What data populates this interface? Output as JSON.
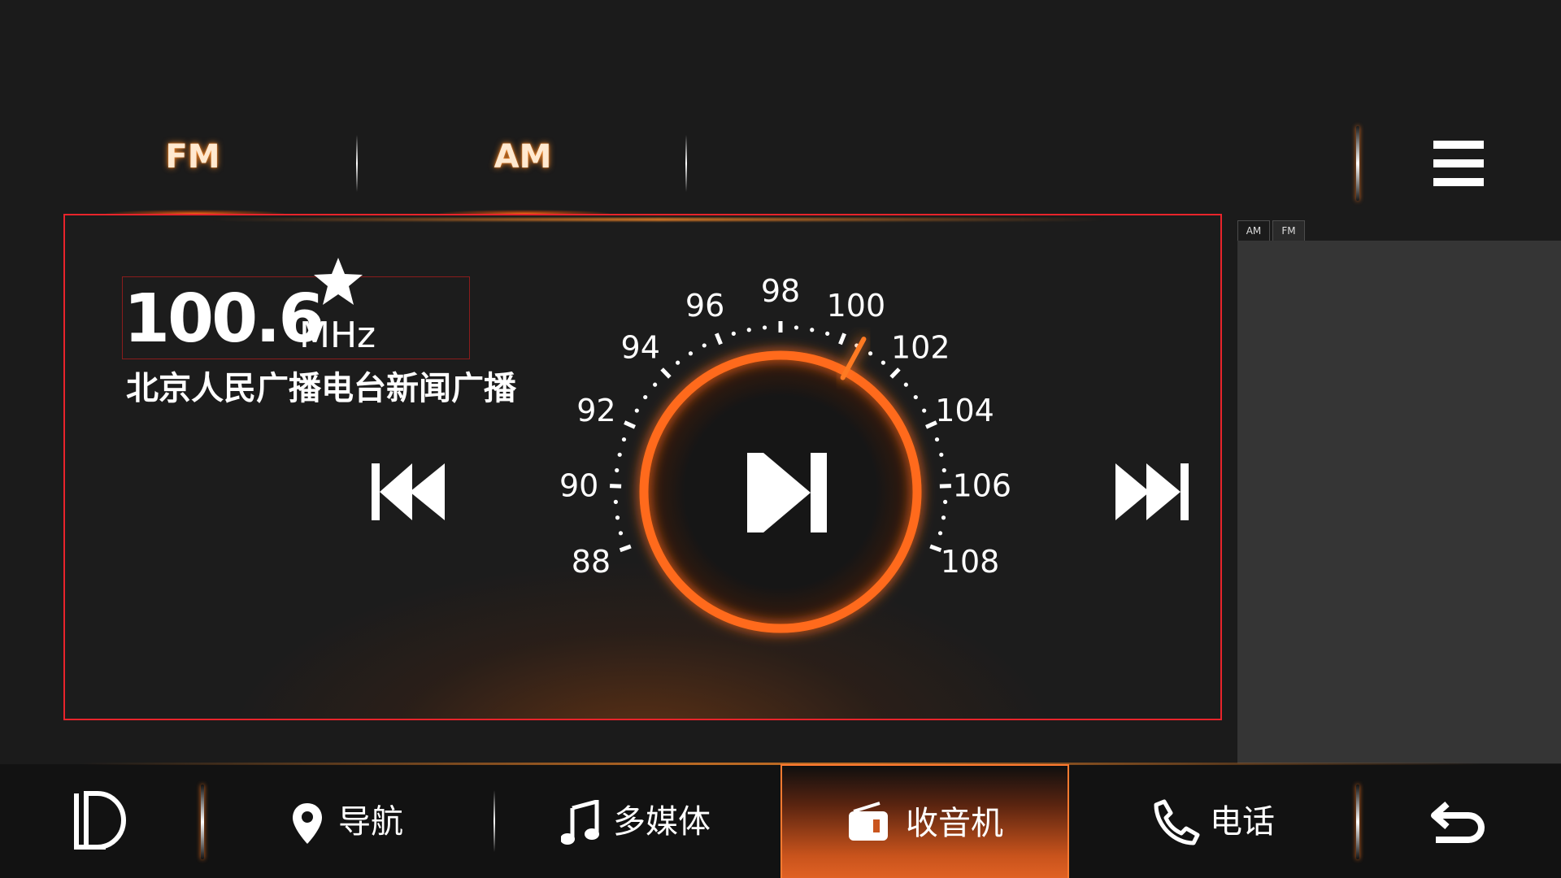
{
  "bands": {
    "fm_label": "FM",
    "am_label": "AM",
    "active": "FM"
  },
  "tuner": {
    "frequency": "100.6",
    "unit": "MHz",
    "station_name": "北京人民广播电台新闻广播",
    "favorite": true,
    "dial_min": 88,
    "dial_max": 108,
    "dial_labels": [
      "88",
      "90",
      "92",
      "94",
      "96",
      "98",
      "100",
      "102",
      "104",
      "106",
      "108"
    ],
    "current_value": 100.6
  },
  "side_panel": {
    "tabs": [
      "AM",
      "FM"
    ]
  },
  "bottom_nav": {
    "items": [
      {
        "label": "导航",
        "icon": "map-pin-icon"
      },
      {
        "label": "多媒体",
        "icon": "music-note-icon"
      },
      {
        "label": "收音机",
        "icon": "radio-icon"
      },
      {
        "label": "电话",
        "icon": "phone-icon"
      }
    ],
    "active": "收音机"
  },
  "colors": {
    "accent": "#ff6a1f",
    "glow": "#ff8a2a",
    "panel_border": "#e8242b",
    "background": "#1b1b1b"
  }
}
